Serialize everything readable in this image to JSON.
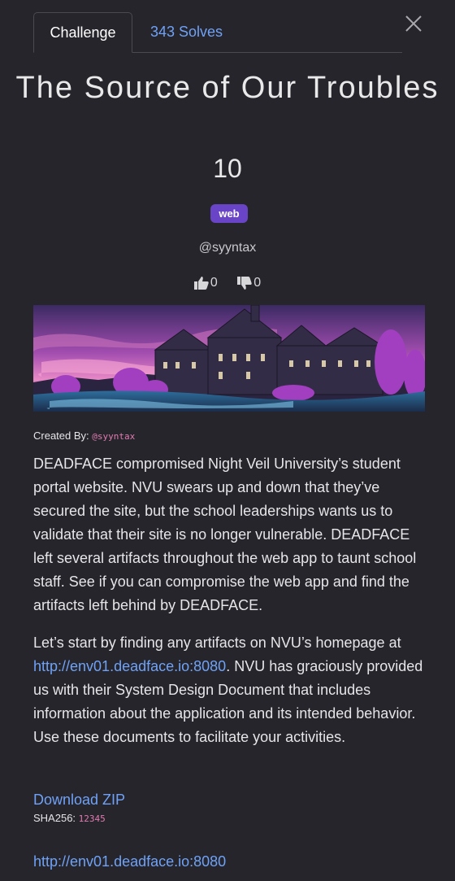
{
  "tabs": {
    "challenge_label": "Challenge",
    "solves_label": "343 Solves"
  },
  "challenge": {
    "title": "The Source of Our Troubles",
    "points": "10",
    "tag": "web",
    "author": "@syyntax",
    "upvotes": "0",
    "downvotes": "0",
    "created_by_label": "Created By:",
    "created_by_user": "@syyntax",
    "paragraph1": "DEADFACE compromised Night Veil University’s student portal website. NVU swears up and down that they’ve secured the site, but the school leaderships wants us to validate that their site is no longer vulnerable. DEADFACE left several artifacts throughout the web app to taunt school staff. See if you can compromise the web app and find the artifacts left behind by DEADFACE.",
    "paragraph2_before_link": "Let’s start by finding any artifacts on NVU’s homepage at ",
    "paragraph2_link": "http://env01.deadface.io:8080",
    "paragraph2_after_link": ". NVU has graciously provided us with their System Design Document that includes information about the application and its intended behavior. Use these documents to facilitate your activities.",
    "download_label": "Download ZIP",
    "sha_label": "SHA256:",
    "sha_value": "12345",
    "bottom_link": "http://env01.deadface.io:8080"
  },
  "colors": {
    "background": "#25252b",
    "link": "#6fa2f7",
    "tag_bg": "#6a44c7",
    "mono_accent": "#e07bb0"
  },
  "icons": {
    "close": "close-icon",
    "upvote": "thumbs-up-icon",
    "downvote": "thumbs-down-icon"
  }
}
